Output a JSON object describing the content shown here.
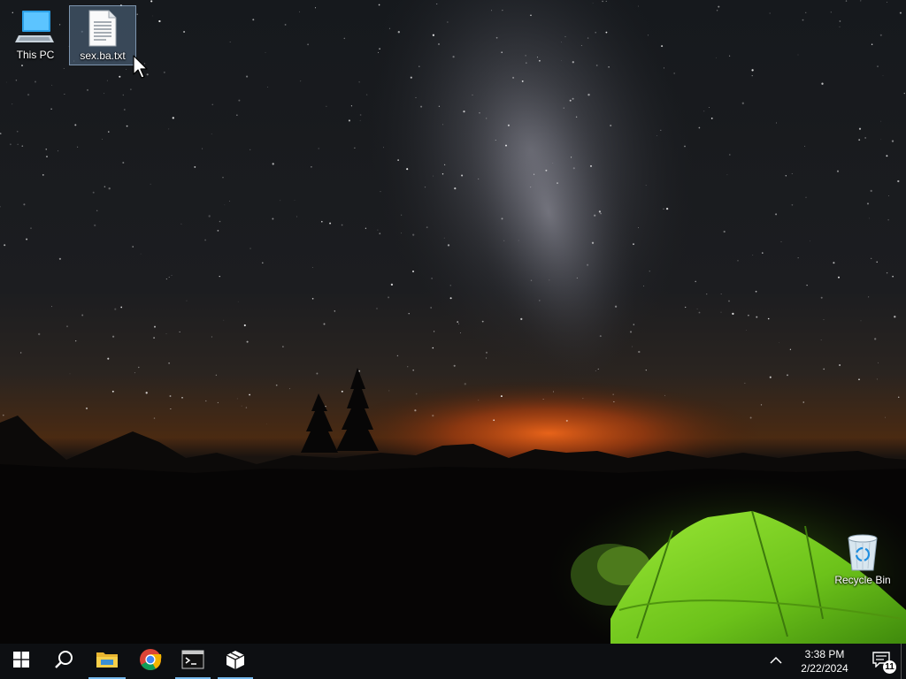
{
  "desktop": {
    "icons": [
      {
        "label": "This PC",
        "icon": "computer-icon"
      },
      {
        "label": "sex.ba.txt",
        "icon": "text-file-icon",
        "selected": true
      },
      {
        "label": "Recycle Bin",
        "icon": "recycle-bin-icon"
      }
    ],
    "wallpaper": "night-sky-milky-way-green-tent"
  },
  "taskbar": {
    "buttons": [
      {
        "name": "start",
        "icon": "windows-logo-icon"
      },
      {
        "name": "search",
        "icon": "search-icon"
      },
      {
        "name": "file-explorer",
        "icon": "folder-icon",
        "running": true
      },
      {
        "name": "chrome",
        "icon": "chrome-icon"
      },
      {
        "name": "terminal",
        "icon": "terminal-icon",
        "running": true
      },
      {
        "name": "package-app",
        "icon": "package-icon",
        "running": true
      }
    ],
    "clock": {
      "time": "3:38 PM",
      "date": "2/22/2024"
    },
    "notifications": {
      "count": "11"
    },
    "colors": {
      "background": "#0d0f12",
      "running_indicator": "#76b9ed"
    }
  }
}
